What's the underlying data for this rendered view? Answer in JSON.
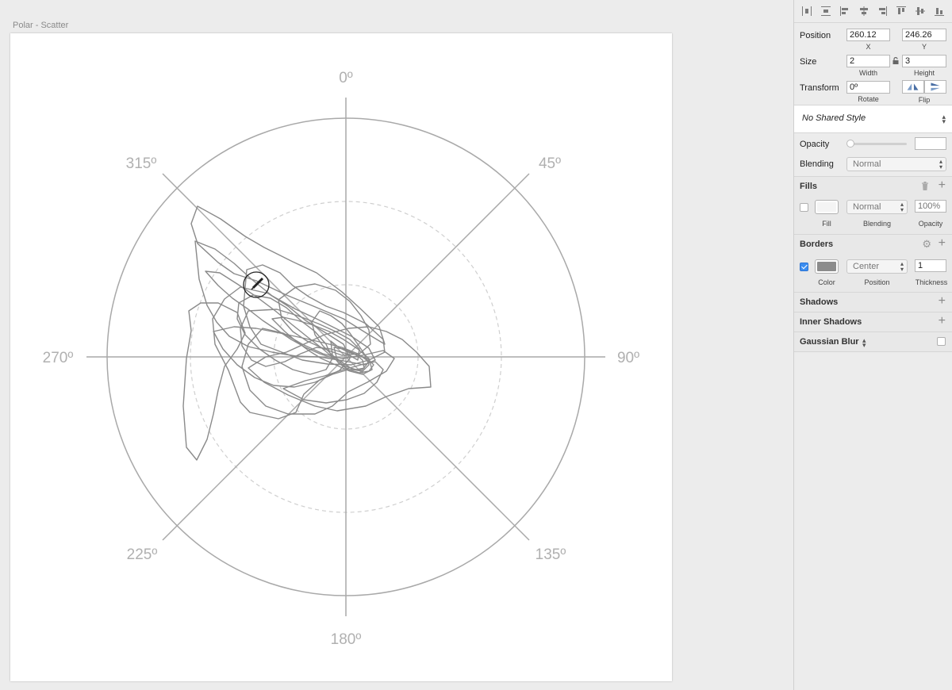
{
  "artboard": {
    "title": "Polar - Scatter",
    "angle_labels": [
      "0º",
      "45º",
      "90º",
      "135º",
      "180º",
      "225º",
      "270º",
      "315º"
    ]
  },
  "inspector": {
    "position": {
      "label": "Position",
      "x": "260.12",
      "y": "246.26",
      "x_sub": "X",
      "y_sub": "Y"
    },
    "size": {
      "label": "Size",
      "width": "2",
      "height": "3",
      "width_sub": "Width",
      "height_sub": "Height"
    },
    "transform": {
      "label": "Transform",
      "rotate": "0º",
      "rotate_sub": "Rotate",
      "flip_sub": "Flip"
    },
    "shared_style": "No Shared Style",
    "opacity": {
      "label": "Opacity",
      "value": ""
    },
    "blending": {
      "label": "Blending",
      "value": "Normal"
    },
    "fills": {
      "header": "Fills",
      "blending": "Normal",
      "opacity_placeholder": "100%",
      "fill_sub": "Fill",
      "blending_sub": "Blending",
      "opacity_sub": "Opacity",
      "enabled": false,
      "color": "#f4f4f4"
    },
    "borders": {
      "header": "Borders",
      "position": "Center",
      "thickness": "1",
      "color_sub": "Color",
      "position_sub": "Position",
      "thickness_sub": "Thickness",
      "enabled": true,
      "color": "#8c8c8c"
    },
    "shadows": "Shadows",
    "inner_shadows": "Inner Shadows",
    "gaussian_blur": "Gaussian Blur"
  }
}
